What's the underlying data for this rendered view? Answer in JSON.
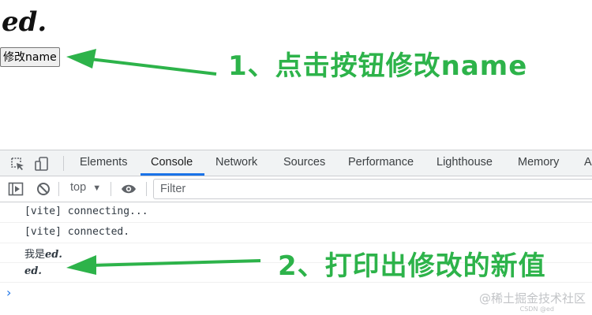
{
  "page": {
    "heading": "ed.",
    "button_label": "修改name"
  },
  "annotations": {
    "step1": "1、点击按钮修改name",
    "step2": "2、打印出修改的新值",
    "arrow_color": "#2db34a"
  },
  "devtools": {
    "tabs": [
      "Elements",
      "Console",
      "Network",
      "Sources",
      "Performance",
      "Lighthouse",
      "Memory",
      "A"
    ],
    "active_tab": "Console",
    "toolbar": {
      "context": "top",
      "filter_placeholder": "Filter"
    },
    "console_lines": [
      "[vite] connecting...",
      "[vite] connected."
    ],
    "log_prefix": "我是",
    "log_value": "ed.",
    "log_value_2": "ed.",
    "prompt_symbol": "›",
    "accent_color": "#1a73e8",
    "icons": [
      "inspect-element-icon",
      "device-toolbar-icon",
      "sidebar-toggle-icon",
      "clear-console-icon",
      "dropdown-caret-icon",
      "live-expression-eye-icon"
    ]
  },
  "watermark": {
    "main": "@稀土掘金技术社区",
    "small": "CSDN @ed"
  }
}
